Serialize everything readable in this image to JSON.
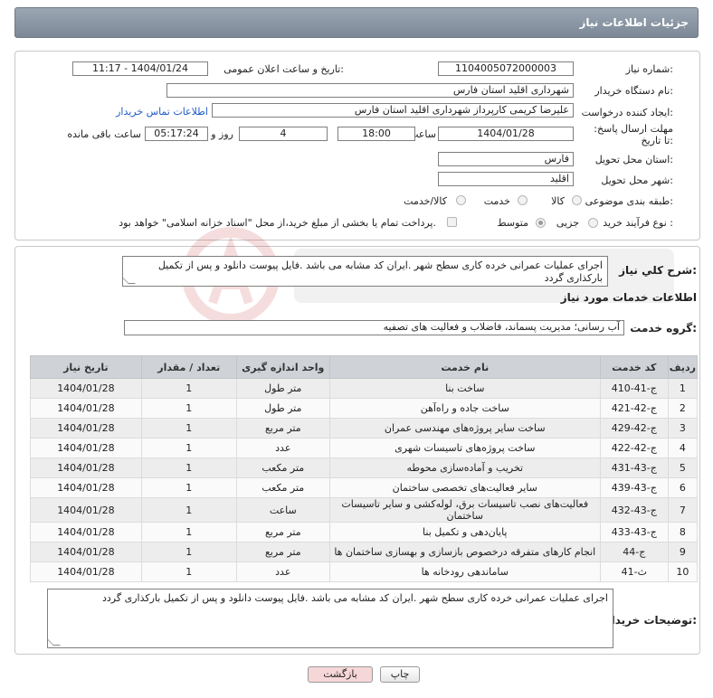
{
  "header": {
    "title": "جزئیات اطلاعات نیاز"
  },
  "info": {
    "need_number_label": "شماره نیاز:",
    "need_number": "1104005072000003",
    "announce_label": "تاریخ و ساعت اعلان عمومی:",
    "announce_value": "1404/01/24 - 11:17",
    "buyer_org_label": "نام دستگاه خریدار:",
    "buyer_org": "شهرداری اقلید استان فارس",
    "creator_label": "ایجاد کننده درخواست:",
    "creator": "علیرضا کریمی  کارپرداز شهرداری اقلید استان فارس",
    "contact_link": "اطلاعات تماس خریدار",
    "deadline_label": "مهلت ارسال پاسخ: تا تاریخ:",
    "deadline_date": "1404/01/28",
    "time_label": "ساعت",
    "deadline_time": "18:00",
    "days_value": "4",
    "days_label": "روز و",
    "remaining_time": "05:17:24",
    "remaining_label": "ساعت باقی مانده",
    "province_label": "استان محل تحویل:",
    "province": "فارس",
    "city_label": "شهر محل تحویل:",
    "city": "اقلید",
    "category_label": "طبقه بندی موضوعی:",
    "category_options": [
      "کالا",
      "خدمت",
      "کالا/خدمت"
    ],
    "process_label": "نوع فرآیند خرید :",
    "process_options": [
      "جزیی",
      "متوسط"
    ],
    "payment_note": "پرداخت تمام یا بخشی از مبلغ خرید،از محل \"اسناد خزانه اسلامی\" خواهد بود."
  },
  "summary": {
    "label": "شرح کلي نياز:",
    "text": "اجرای عملیات عمرانی خرده کاری سطح شهر .ایران کد مشابه می باشد .فایل پیوست دانلود و پس از تکمیل بارکذاری گردد"
  },
  "services": {
    "section_title": "اطلاعات خدمات مورد نياز",
    "group_label": "گروه خدمت:",
    "group_value": "آب رسانی؛ مدیریت پسماند، فاضلاب و فعالیت های تصفیه",
    "columns": [
      "ردیف",
      "کد خدمت",
      "نام خدمت",
      "واحد اندازه گیری",
      "تعداد / مقدار",
      "تاریخ نیاز"
    ],
    "rows": [
      [
        "1",
        "ج-41-410",
        "ساخت بنا",
        "متر طول",
        "1",
        "1404/01/28"
      ],
      [
        "2",
        "ج-42-421",
        "ساخت جاده و راه‌آهن",
        "متر طول",
        "1",
        "1404/01/28"
      ],
      [
        "3",
        "ج-42-429",
        "ساخت سایر پروژه‌های مهندسی عمران",
        "متر مربع",
        "1",
        "1404/01/28"
      ],
      [
        "4",
        "ج-42-422",
        "ساخت پروژه‌های تاسیسات شهری",
        "عدد",
        "1",
        "1404/01/28"
      ],
      [
        "5",
        "ج-43-431",
        "تخریب و آماده‌سازی محوطه",
        "متر مکعب",
        "1",
        "1404/01/28"
      ],
      [
        "6",
        "ج-43-439",
        "سایر فعالیت‌های تخصصی ساختمان",
        "متر مکعب",
        "1",
        "1404/01/28"
      ],
      [
        "7",
        "ج-43-432",
        "فعالیت‌های نصب تاسیسات برق، لوله‌کشی و سایر تاسیسات ساختمان",
        "ساعت",
        "1",
        "1404/01/28"
      ],
      [
        "8",
        "ج-43-433",
        "پایان‌دهی و تکمیل بنا",
        "متر مربع",
        "1",
        "1404/01/28"
      ],
      [
        "9",
        "ج-44",
        "انجام کارهای متفرقه درخصوص بازسازی و بهسازی ساختمان ها",
        "متر مربع",
        "1",
        "1404/01/28"
      ],
      [
        "10",
        "ث-41",
        "ساماندهی رودخانه ها",
        "عدد",
        "1",
        "1404/01/28"
      ]
    ]
  },
  "buyer_notes": {
    "label": "توضیحات خریدار:",
    "text": "اجرای عملیات عمرانی خرده کاری سطح شهر .ایران کد مشابه می باشد .فایل پیوست دانلود و پس از تکمیل بارکذاری گردد"
  },
  "buttons": {
    "print": "چاپ",
    "back": "بازگشت"
  },
  "colors": {
    "header": "#8a96a3",
    "back_button": "#f6d7d7",
    "link": "#1f5bc7"
  }
}
